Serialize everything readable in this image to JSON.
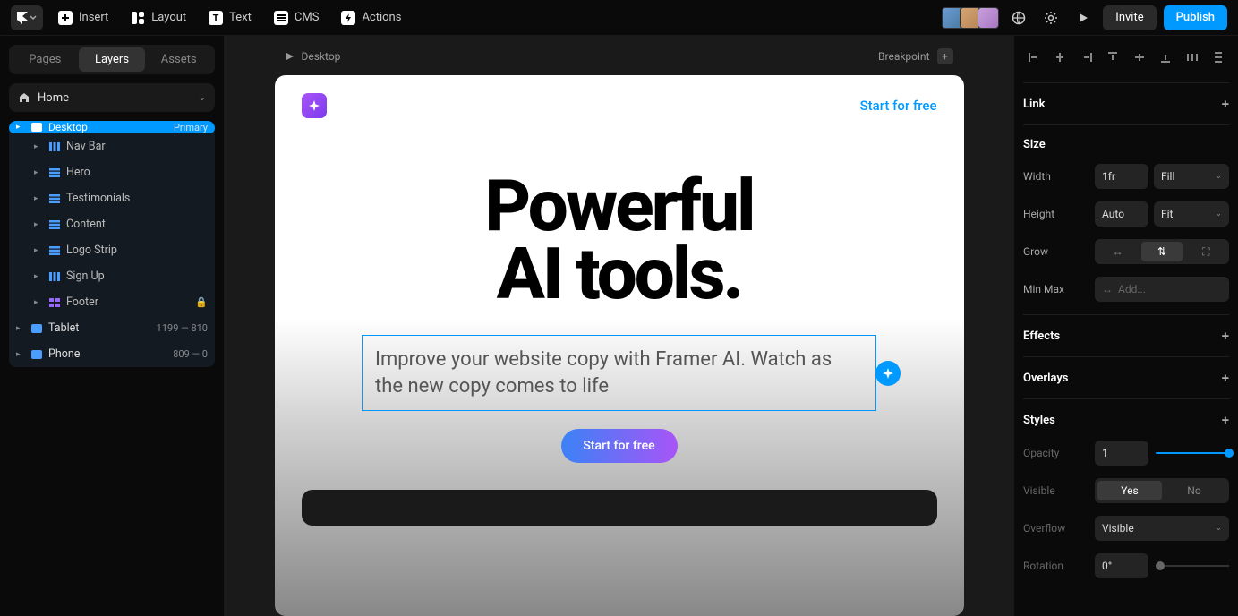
{
  "topbar": {
    "insert": "Insert",
    "layout": "Layout",
    "text": "Text",
    "cms": "CMS",
    "actions": "Actions",
    "invite": "Invite",
    "publish": "Publish"
  },
  "left": {
    "tabs": {
      "pages": "Pages",
      "layers": "Layers",
      "assets": "Assets"
    },
    "home": "Home",
    "tree": [
      {
        "label": "Desktop",
        "tag": "Primary",
        "selected": true,
        "root": true
      },
      {
        "label": "Nav Bar",
        "child": true,
        "icon": "cols"
      },
      {
        "label": "Hero",
        "child": true,
        "icon": "stack"
      },
      {
        "label": "Testimonials",
        "child": true,
        "icon": "stack"
      },
      {
        "label": "Content",
        "child": true,
        "icon": "stack"
      },
      {
        "label": "Logo Strip",
        "child": true,
        "icon": "stack"
      },
      {
        "label": "Sign Up",
        "child": true,
        "icon": "cols"
      },
      {
        "label": "Footer",
        "child": true,
        "icon": "grid",
        "lock": true
      },
      {
        "label": "Tablet",
        "root": true,
        "tag": "1199 — 810"
      },
      {
        "label": "Phone",
        "root": true,
        "tag": "809 — 0"
      }
    ]
  },
  "viewport": {
    "label": "Desktop",
    "breakpoint": "Breakpoint"
  },
  "hero": {
    "title_l1": "Powerful",
    "title_l2": "AI tools.",
    "sub": "Improve your website copy with Framer AI. Watch as the new copy comes to life",
    "nav_cta": "Start for free",
    "cta": "Start for free"
  },
  "right": {
    "link": "Link",
    "size": "Size",
    "width": "Width",
    "width_val": "1fr",
    "width_mode": "Fill",
    "height": "Height",
    "height_val": "Auto",
    "height_mode": "Fit",
    "grow": "Grow",
    "minmax": "Min Max",
    "minmax_ph": "Add...",
    "effects": "Effects",
    "overlays": "Overlays",
    "styles": "Styles",
    "opacity": "Opacity",
    "opacity_val": "1",
    "visible": "Visible",
    "yes": "Yes",
    "no": "No",
    "overflow": "Overflow",
    "overflow_val": "Visible",
    "rotation": "Rotation",
    "rotation_val": "0°"
  }
}
